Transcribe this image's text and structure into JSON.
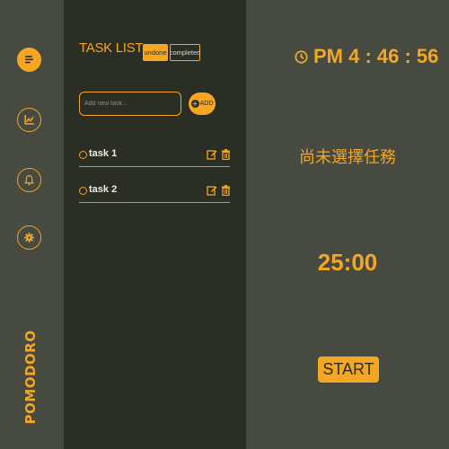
{
  "sidebar": {
    "brand": "POMODORO",
    "items": [
      {
        "icon": "list-icon",
        "active": true
      },
      {
        "icon": "chart-icon",
        "active": false
      },
      {
        "icon": "bell-icon",
        "active": false
      },
      {
        "icon": "gear-icon",
        "active": false
      }
    ]
  },
  "tasks": {
    "title": "TASK LIST",
    "tabs": [
      {
        "label": "undone",
        "active": true
      },
      {
        "label": "completed",
        "active": false
      }
    ],
    "input_placeholder": "Add new task...",
    "add_label": "ADD",
    "items": [
      {
        "name": "task 1"
      },
      {
        "name": "task 2"
      }
    ]
  },
  "timer": {
    "clock": "PM 4 : 46 : 56",
    "status": "尚未選擇任務",
    "countdown": "25:00",
    "start_label": "START"
  },
  "colors": {
    "accent": "#f5a623",
    "panel_dark": "#2b2e24",
    "background": "#474a41"
  }
}
